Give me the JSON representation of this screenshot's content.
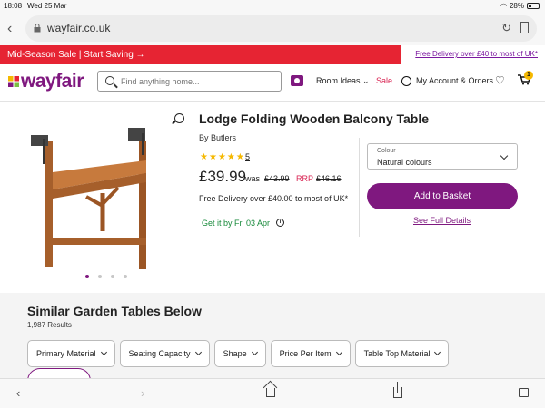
{
  "status": {
    "time": "18:08",
    "date": "Wed 25 Mar",
    "battery": "28%"
  },
  "browser": {
    "url": "wayfair.co.uk"
  },
  "promo": {
    "left": "Mid-Season Sale | Start Saving →",
    "right": "Free Delivery over £40 to most of UK*"
  },
  "header": {
    "logo": "wayfair",
    "search_placeholder": "Find anything home...",
    "room_ideas": "Room Ideas",
    "sale": "Sale",
    "account": "My Account & Orders",
    "cart_count": "1"
  },
  "product": {
    "title": "Lodge Folding Wooden Balcony Table",
    "brand": "By Butlers",
    "rating": 5,
    "review_count": "5",
    "price": "£39.99",
    "was_label": "was",
    "was_price": "£43.99",
    "rrp_label": "RRP",
    "rrp_price": "£46.16",
    "delivery": "Free Delivery over £40.00 to most of UK*",
    "get_it": "Get it by Fri 03 Apr",
    "colour_label": "Colour",
    "colour_value": "Natural colours",
    "add_button": "Add to Basket",
    "see_details": "See Full Details",
    "image_count": 4,
    "active_image": 1
  },
  "similar": {
    "title": "Similar Garden Tables Below",
    "results": "1,987 Results",
    "filters": [
      "Primary Material",
      "Seating Capacity",
      "Shape",
      "Price Per Item",
      "Table Top Material"
    ]
  },
  "colors": {
    "brand": "#7f187f",
    "sale_red": "#e62433",
    "rating": "#f5b800"
  }
}
